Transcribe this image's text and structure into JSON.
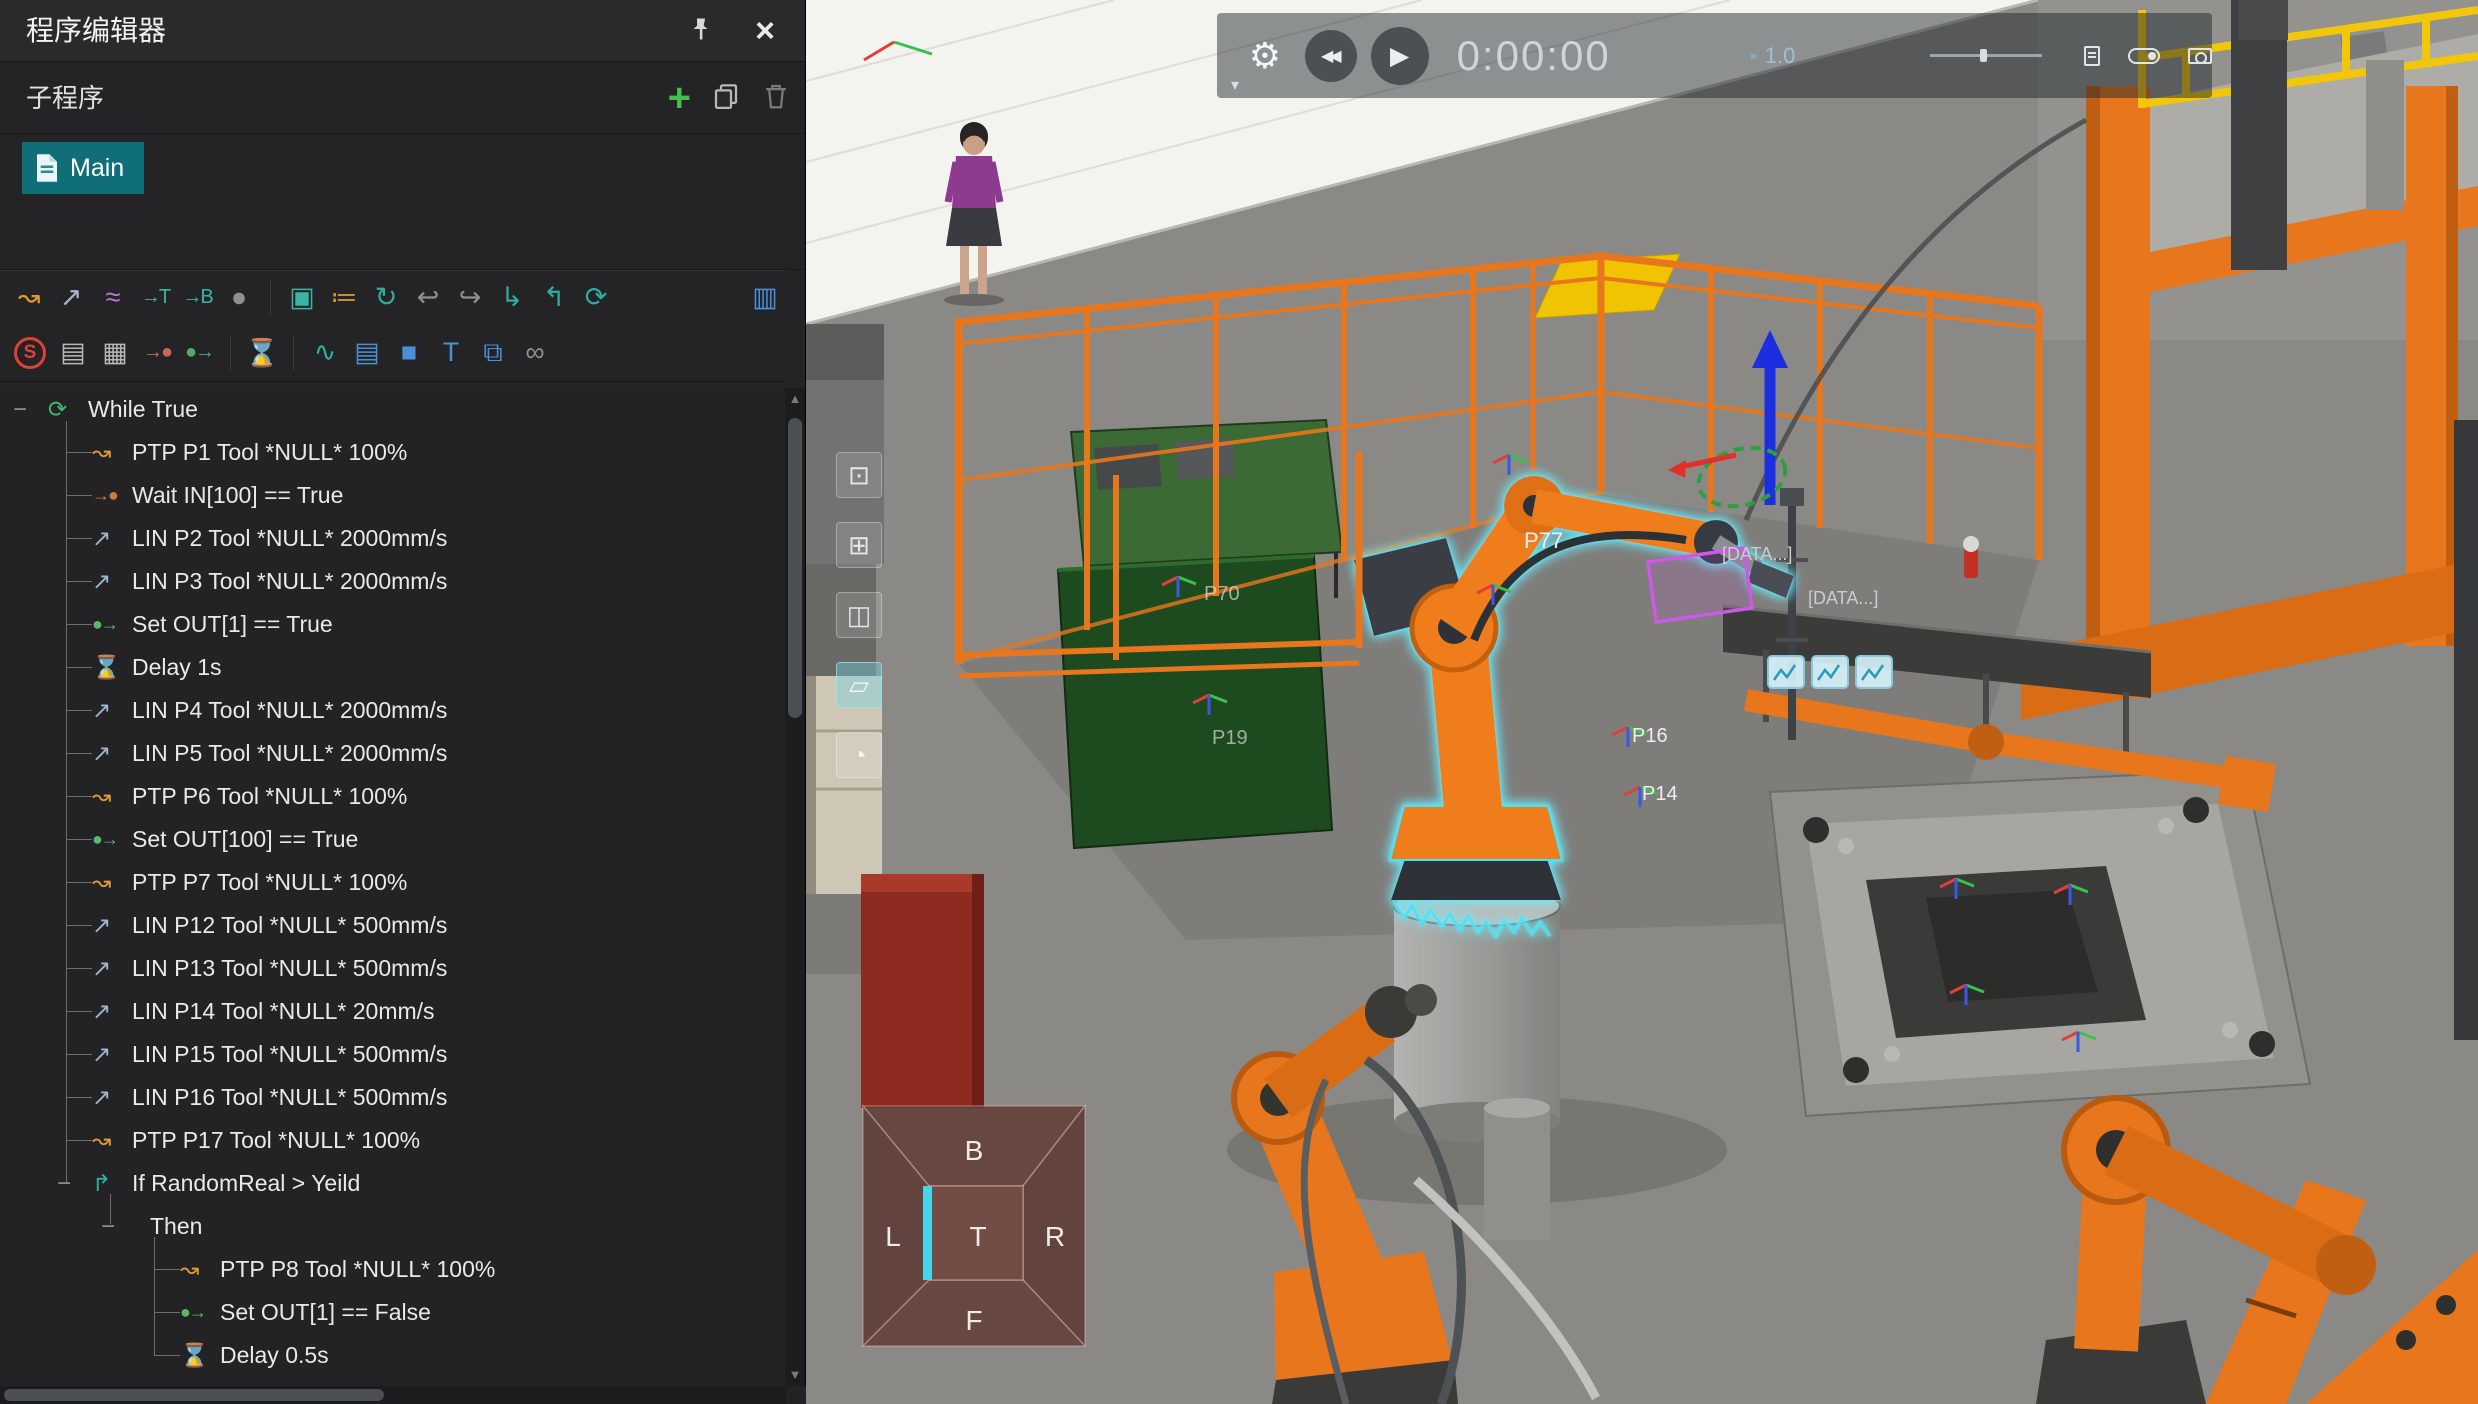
{
  "colors": {
    "accent_teal": "#0f6e78",
    "fence_orange": "#e8761c",
    "highlight_cyan": "#45d6e8",
    "panel_bg": "#242426",
    "status_red": "#e04038"
  },
  "panel": {
    "title": "程序编辑器",
    "subprogram_label": "子程序",
    "main_tab": "Main"
  },
  "toolbar1": [
    {
      "name": "ptp-move-icon",
      "glyph": "↝",
      "color": "#e09a2e"
    },
    {
      "name": "lin-move-icon",
      "glyph": "↗",
      "color": "#9fb6cc"
    },
    {
      "name": "spline-move-icon",
      "glyph": "≈",
      "color": "#b57ad0"
    },
    {
      "name": "set-tool-icon",
      "glyph": "→T",
      "color": "#3db3a6"
    },
    {
      "name": "set-base-icon",
      "glyph": "→B",
      "color": "#3db3a6"
    },
    {
      "name": "record-point-icon",
      "glyph": "●",
      "color": "#8f8f8f"
    },
    {
      "sep": true
    },
    {
      "name": "subprogram-icon",
      "glyph": "▣",
      "color": "#3db3a6"
    },
    {
      "name": "io-list-icon",
      "glyph": "≔",
      "color": "#d08a30"
    },
    {
      "name": "loop-icon",
      "glyph": "↻",
      "color": "#2fae9f"
    },
    {
      "name": "return-icon",
      "glyph": "↩",
      "color": "#8f8f8f"
    },
    {
      "name": "jump-icon",
      "glyph": "↪",
      "color": "#8f8f8f"
    },
    {
      "name": "branch-icon",
      "glyph": "↳",
      "color": "#2fae9f"
    },
    {
      "name": "insert-icon",
      "glyph": "↰",
      "color": "#2fae9f"
    },
    {
      "name": "refresh-icon",
      "glyph": "⟳",
      "color": "#2fae9f"
    },
    {
      "name": "dock-icon",
      "glyph": "▥",
      "color": "#4a90d8",
      "push": true
    }
  ],
  "toolbar2": [
    {
      "name": "stop-icon",
      "glyph": "S",
      "color": "#e04038",
      "circle": true
    },
    {
      "name": "file-icon",
      "glyph": "▤",
      "color": "#b8b8b8"
    },
    {
      "name": "print-icon",
      "glyph": "▦",
      "color": "#b8b8b8"
    },
    {
      "name": "signal-in-icon",
      "glyph": "→●",
      "color": "#c86858"
    },
    {
      "name": "signal-out-icon",
      "glyph": "●→",
      "color": "#58a868"
    },
    {
      "sep": true
    },
    {
      "name": "timer-icon",
      "glyph": "⌛",
      "color": "#d08a30"
    },
    {
      "sep": true
    },
    {
      "name": "chart-icon",
      "glyph": "∿",
      "color": "#2fae9f"
    },
    {
      "name": "report-icon",
      "glyph": "▤",
      "color": "#4a90d8"
    },
    {
      "name": "cube-icon",
      "glyph": "■",
      "color": "#4a90d8"
    },
    {
      "name": "text-tool-icon",
      "glyph": "T",
      "color": "#4a90d8"
    },
    {
      "name": "copy-pages-icon",
      "glyph": "⧉",
      "color": "#4a90d8"
    },
    {
      "name": "unlink-icon",
      "glyph": "∞",
      "color": "#8f8f8f"
    }
  ],
  "tree": {
    "icons": {
      "while": {
        "glyph": "⟳",
        "color": "#45b868"
      },
      "ptp": {
        "glyph": "↝",
        "color": "#e09a2e"
      },
      "lin": {
        "glyph": "↗",
        "color": "#9fb6cc"
      },
      "wait": {
        "glyph": "→●",
        "color": "#cc7a3a"
      },
      "setout": {
        "glyph": "●→",
        "color": "#58b868"
      },
      "delay": {
        "glyph": "⌛",
        "color": "#5a9fd4"
      },
      "if": {
        "glyph": "↱",
        "color": "#2fae9f"
      }
    },
    "rows": [
      {
        "kind": "while",
        "level": 0,
        "expander": true,
        "label": "While True"
      },
      {
        "kind": "ptp",
        "level": 1,
        "label": "PTP P1 Tool *NULL* 100%"
      },
      {
        "kind": "wait",
        "level": 1,
        "label": "Wait IN[100] == True"
      },
      {
        "kind": "lin",
        "level": 1,
        "label": "LIN P2 Tool *NULL* 2000mm/s"
      },
      {
        "kind": "lin",
        "level": 1,
        "label": "LIN P3 Tool *NULL* 2000mm/s"
      },
      {
        "kind": "setout",
        "level": 1,
        "label": "Set OUT[1] == True"
      },
      {
        "kind": "delay",
        "level": 1,
        "label": "Delay 1s"
      },
      {
        "kind": "lin",
        "level": 1,
        "label": "LIN P4 Tool *NULL* 2000mm/s"
      },
      {
        "kind": "lin",
        "level": 1,
        "label": "LIN P5 Tool *NULL* 2000mm/s"
      },
      {
        "kind": "ptp",
        "level": 1,
        "label": "PTP P6 Tool *NULL* 100%"
      },
      {
        "kind": "setout",
        "level": 1,
        "label": "Set OUT[100] == True"
      },
      {
        "kind": "ptp",
        "level": 1,
        "label": "PTP P7 Tool *NULL* 100%"
      },
      {
        "kind": "lin",
        "level": 1,
        "label": "LIN P12 Tool *NULL* 500mm/s"
      },
      {
        "kind": "lin",
        "level": 1,
        "label": "LIN P13 Tool *NULL* 500mm/s"
      },
      {
        "kind": "lin",
        "level": 1,
        "label": "LIN P14 Tool *NULL* 20mm/s"
      },
      {
        "kind": "lin",
        "level": 1,
        "label": "LIN P15 Tool *NULL* 500mm/s"
      },
      {
        "kind": "lin",
        "level": 1,
        "label": "LIN P16 Tool *NULL* 500mm/s"
      },
      {
        "kind": "ptp",
        "level": 1,
        "label": "PTP P17 Tool *NULL* 100%"
      },
      {
        "kind": "if",
        "level": 1,
        "expander": true,
        "label": "If RandomReal > Yeild"
      },
      {
        "kind": "then",
        "level": 2,
        "expander": true,
        "label": "Then"
      },
      {
        "kind": "ptp",
        "level": 3,
        "label": "PTP P8 Tool *NULL* 100%"
      },
      {
        "kind": "setout",
        "level": 3,
        "label": "Set OUT[1] == False"
      },
      {
        "kind": "delay",
        "level": 3,
        "label": "Delay 0.5s"
      }
    ]
  },
  "playback": {
    "time": "0:00:00",
    "speed": "1.0"
  },
  "viewcube": {
    "back": "B",
    "left": "L",
    "top": "T",
    "right": "R",
    "front": "F"
  },
  "scene_labels": {
    "p77": "P77",
    "data_tag_1": "[DATA...]",
    "data_tag_2": "[DATA...]",
    "p16": "P16",
    "p14": "P14",
    "p70": "P70",
    "p19": "P19"
  },
  "ghost_tools": [
    {
      "name": "fit-view-icon",
      "glyph": "⊡"
    },
    {
      "name": "select-frame-icon",
      "glyph": "⊞"
    },
    {
      "name": "box-select-icon",
      "glyph": "◫"
    },
    {
      "name": "plane-tool-icon",
      "glyph": "▱",
      "teal": true
    },
    {
      "name": "orbit-view-icon",
      "glyph": "◔"
    }
  ]
}
